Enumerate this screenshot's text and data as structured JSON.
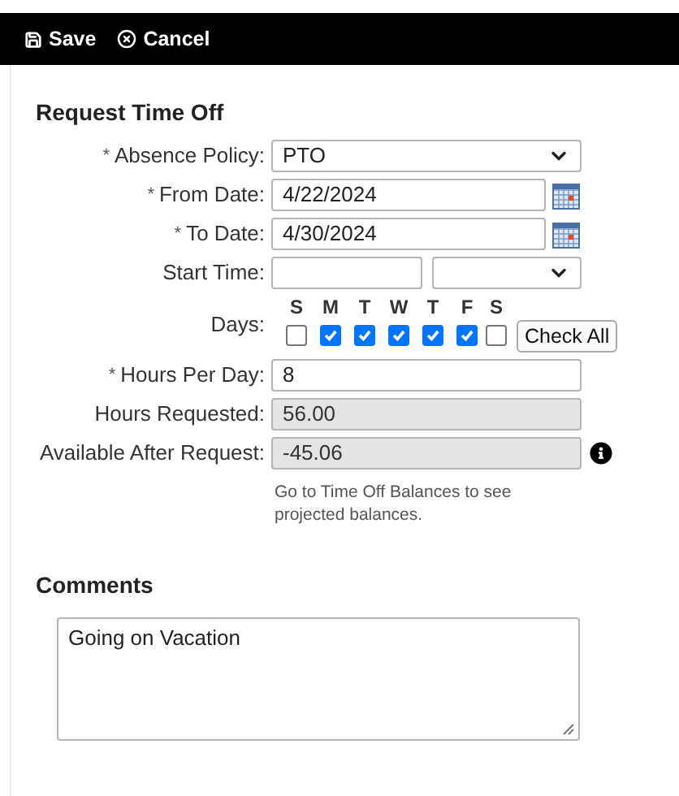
{
  "toolbar": [
    {
      "kind": "save",
      "label": "Save"
    },
    {
      "kind": "cancel",
      "label": "Cancel"
    }
  ],
  "title": "Request Time Off",
  "fields": [
    {
      "kind": "select",
      "mark": "*",
      "label": "Absence Policy:",
      "value": "PTO"
    },
    {
      "kind": "date",
      "mark": "*",
      "label": "From Date:",
      "value": "4/22/2024"
    },
    {
      "kind": "date",
      "mark": "*",
      "label": "To Date:",
      "value": "4/30/2024"
    },
    {
      "kind": "time",
      "label": "Start Time:"
    },
    {
      "kind": "days",
      "label": "Days:",
      "button": "Check All",
      "days": [
        {
          "letter": "S",
          "checked": false
        },
        {
          "letter": "M",
          "checked": true
        },
        {
          "letter": "T",
          "checked": true
        },
        {
          "letter": "W",
          "checked": true
        },
        {
          "letter": "T",
          "checked": true
        },
        {
          "letter": "F",
          "checked": true
        },
        {
          "letter": "S",
          "checked": false
        }
      ]
    },
    {
      "kind": "text",
      "mark": "*",
      "label": "Hours Per Day:",
      "value": "8",
      "disabled": false
    },
    {
      "kind": "text",
      "label": "Hours Requested:",
      "value": "56.00",
      "disabled": true
    },
    {
      "kind": "text",
      "label": "Available After Request:",
      "value": "-45.06",
      "disabled": true,
      "info": true
    }
  ],
  "help": "Go to Time Off Balances to see projected balances.",
  "comments": {
    "heading": "Comments",
    "value": "Going on Vacation"
  }
}
